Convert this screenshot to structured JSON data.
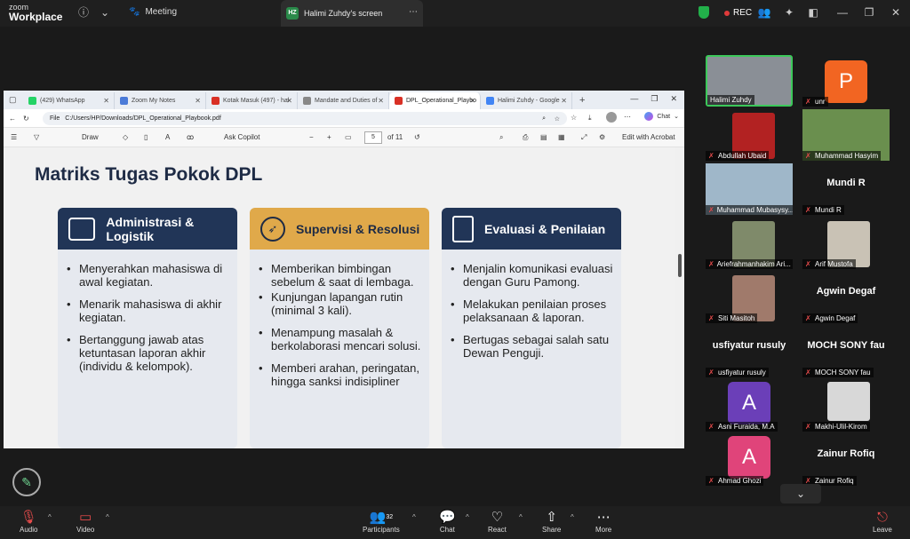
{
  "app": {
    "brand_top": "zoom",
    "brand_bottom": "Workplace"
  },
  "topbar": {
    "meeting_label": "Meeting",
    "share_tab": {
      "initials": "HZ",
      "label": "Halimi Zuhdy's screen"
    },
    "rec_label": "REC"
  },
  "browser": {
    "tabs": [
      {
        "label": "(429) WhatsApp",
        "color": "#25d366"
      },
      {
        "label": "Zoom My Notes",
        "color": "#4b7bd8"
      },
      {
        "label": "Kotak Masuk (497) - hal",
        "color": "#d93025"
      },
      {
        "label": "Mandate and Duties of",
        "color": "#888888"
      },
      {
        "label": "DPL_Operational_Playbo",
        "color": "#d93025"
      },
      {
        "label": "Halimi Zuhdy - Google",
        "color": "#4285f4"
      }
    ],
    "url_prefix": "File",
    "url": "C:/Users/HP/Downloads/DPL_Operational_Playbook.pdf",
    "chat_label": "Chat"
  },
  "pdf_toolbar": {
    "draw": "Draw",
    "ask_copilot": "Ask Copilot",
    "page_current": "5",
    "page_total": "of 11",
    "edit_acrobat": "Edit with Acrobat"
  },
  "slide": {
    "title": "Matriks Tugas Pokok DPL",
    "cards": [
      {
        "title": "Administrasi & Logistik",
        "bullets": [
          "Menyerahkan mahasiswa di awal kegiatan.",
          "Menarik mahasiswa di akhir kegiatan.",
          "Bertanggung jawab atas ketuntasan laporan akhir (individu & kelompok)."
        ]
      },
      {
        "title": "Supervisi & Resolusi",
        "bullets": [
          "Memberikan bimbingan sebelum & saat di lembaga.",
          "Kunjungan lapangan rutin (minimal 3 kali).",
          "Menampung masalah & berkolaborasi mencari solusi.",
          "Memberi arahan, peringatan, hingga sanksi indisipliner"
        ]
      },
      {
        "title": "Evaluasi & Penilaian",
        "bullets": [
          "Menjalin komunikasi evaluasi dengan Guru Pamong.",
          "Melakukan penilaian proses pelaksanaan & laporan.",
          "Bertugas sebagai salah satu Dewan Penguji."
        ]
      }
    ]
  },
  "participants": [
    {
      "name": "Halimi Zuhdy",
      "kind": "photo",
      "color": "#8a8f96",
      "muted": false
    },
    {
      "name": "unr",
      "kind": "avatar",
      "letter": "P",
      "color": "#f26522",
      "muted": true
    },
    {
      "name": "Abdullah Ubaid",
      "kind": "photo",
      "color": "#b22222",
      "muted": true
    },
    {
      "name": "Muhammad Hasyim",
      "kind": "photo",
      "color": "#6a8f4e",
      "muted": true
    },
    {
      "name": "Muhammad Mubasysy...",
      "kind": "photo",
      "color": "#9fb7c9",
      "muted": true
    },
    {
      "name": "Mundi R",
      "kind": "name",
      "big": "Mundi R",
      "muted": true
    },
    {
      "name": "Ariefrahmanhakim Ari...",
      "kind": "photo",
      "color": "#7f8a6a",
      "muted": true
    },
    {
      "name": "Arif Mustofa",
      "kind": "photo",
      "color": "#c9c2b5",
      "muted": true
    },
    {
      "name": "Siti Masitoh",
      "kind": "photo",
      "color": "#a07a6b",
      "muted": true
    },
    {
      "name": "Agwin Degaf",
      "kind": "name",
      "big": "Agwin Degaf",
      "muted": true
    },
    {
      "name": "usfiyatur rusuly",
      "kind": "name",
      "big": "usfiyatur rusuly",
      "muted": true
    },
    {
      "name": "MOCH SONY fau",
      "kind": "name",
      "big": "MOCH SONY fau",
      "muted": true
    },
    {
      "name": "Asni Furaida, M.A",
      "kind": "avatar",
      "letter": "A",
      "color": "#6b3fb8",
      "muted": true
    },
    {
      "name": "Makhi-Ulil-Kirom",
      "kind": "photo",
      "color": "#d8d8d8",
      "muted": true
    },
    {
      "name": "Ahmad Ghozi",
      "kind": "avatar",
      "letter": "A",
      "color": "#e0447a",
      "muted": true
    },
    {
      "name": "Zainur Rofiq",
      "kind": "name",
      "big": "Zainur Rofiq",
      "muted": true
    }
  ],
  "bottombar": {
    "audio": "Audio",
    "video": "Video",
    "participants": "Participants",
    "participants_count": "32",
    "chat": "Chat",
    "react": "React",
    "share": "Share",
    "more": "More",
    "leave": "Leave"
  }
}
